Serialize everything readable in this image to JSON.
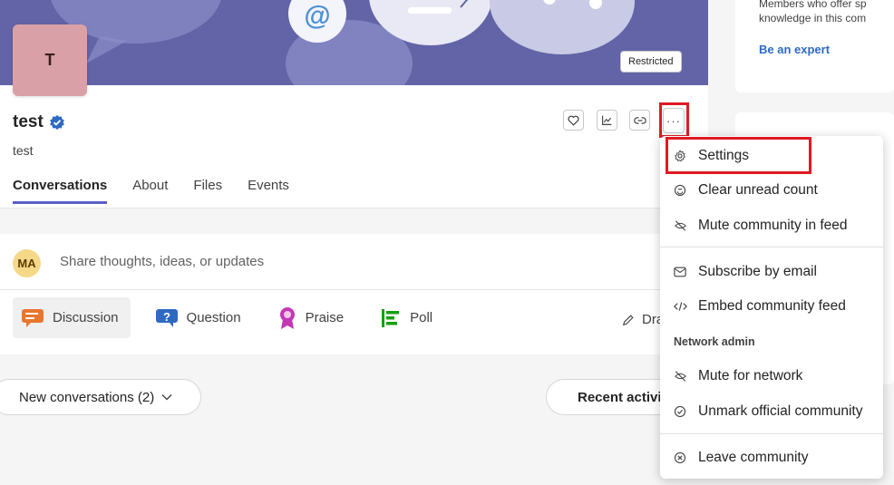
{
  "cover": {
    "avatar_letter": "T",
    "badge": "Restricted"
  },
  "community": {
    "title": "test",
    "subtitle": "test"
  },
  "tabs": [
    {
      "label": "Conversations",
      "active": true
    },
    {
      "label": "About",
      "active": false
    },
    {
      "label": "Files",
      "active": false
    },
    {
      "label": "Events",
      "active": false
    }
  ],
  "toolbar": {
    "more_label": "···",
    "icons": [
      "heart-icon",
      "analytics-icon",
      "link-icon",
      "more-icon"
    ]
  },
  "composer": {
    "avatar_initials": "MA",
    "placeholder": "Share thoughts, ideas, or updates",
    "post_types": [
      {
        "label": "Discussion",
        "icon": "discussion-icon",
        "selected": true
      },
      {
        "label": "Question",
        "icon": "question-icon",
        "selected": false
      },
      {
        "label": "Praise",
        "icon": "praise-icon",
        "selected": false
      },
      {
        "label": "Poll",
        "icon": "poll-icon",
        "selected": false
      }
    ],
    "draft_label": "Dra"
  },
  "feed": {
    "filter_new": "New conversations (2)",
    "filter_recent": "Recent activi"
  },
  "right_panel": {
    "experts_line1": "Members who offer sp",
    "experts_line2": "knowledge in this com",
    "be_expert": "Be an expert"
  },
  "menu": {
    "items": [
      {
        "label": "Settings",
        "icon": "gear-icon"
      },
      {
        "label": "Clear unread count",
        "icon": "clear-unread-icon"
      },
      {
        "label": "Mute community in feed",
        "icon": "mute-eye-icon"
      },
      {
        "label": "Subscribe by email",
        "icon": "mail-icon"
      },
      {
        "label": "Embed community feed",
        "icon": "code-icon"
      },
      {
        "label": "Mute for network",
        "icon": "mute-eye-icon"
      },
      {
        "label": "Unmark official community",
        "icon": "check-circle-icon"
      },
      {
        "label": "Leave community",
        "icon": "close-circle-icon"
      }
    ],
    "section_label": "Network admin"
  },
  "colors": {
    "brand": "#5b5fc7",
    "cover": "#6264a7",
    "highlight": "#e01b24",
    "link": "#2f6ac1"
  }
}
